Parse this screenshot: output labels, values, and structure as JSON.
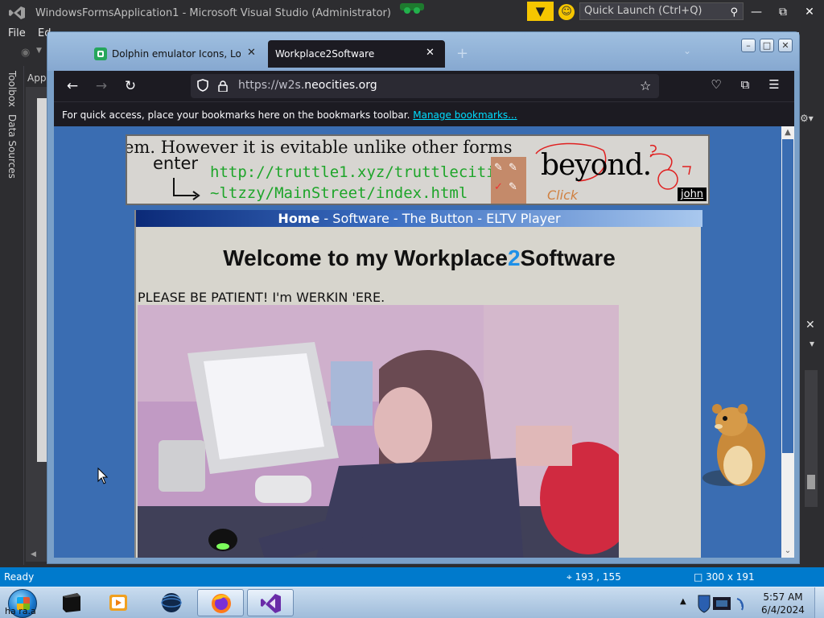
{
  "vs": {
    "title": "WindowsFormsApplication1 - Microsoft Visual Studio (Administrator)",
    "quick_launch_placeholder": "Quick Launch (Ctrl+Q)",
    "menu": {
      "file": "File",
      "edit_partial": "Ed"
    },
    "left_tabs": {
      "toolbox": "Toolbox",
      "data_sources": "Data Sources"
    },
    "editor_tab_partial": "App",
    "status": {
      "ready": "Ready",
      "position": "193 , 155",
      "size": "300 x 191"
    },
    "colors": {
      "status_bar": "#007acc",
      "chrome": "#2d2d30"
    }
  },
  "firefox": {
    "tabs": [
      {
        "label": "Dolphin emulator Icons, Logos, Symbols",
        "favicon": "dolphin-favicon",
        "active": false
      },
      {
        "label": "Workplace2Software",
        "active": true
      }
    ],
    "url": {
      "prefix": "https://w2s.",
      "domain": "neocities.org"
    },
    "bookmarks_msg": "For quick access, place your bookmarks here on the bookmarks toolbar.",
    "bookmarks_link": "Manage bookmarks..."
  },
  "site": {
    "banner": {
      "marquee": "em. However it is evitable unlike other forms",
      "enter": "enter",
      "url_line1": "http://truttle1.xyz/truttlecities/",
      "url_line2": "~ltzzy/MainStreet/index.html",
      "beyond": "beyond.",
      "click": "Click",
      "john": "john"
    },
    "nav": {
      "home": "Home",
      "sep": " - ",
      "software": "Software",
      "button": "The Button",
      "eltv": "ELTV Player"
    },
    "title_pre": "Welcome to my Workplace",
    "title_num": "2",
    "title_post": "Software",
    "warning": "PLEASE BE PATIENT! I'm WERKIN 'ERE.",
    "colors": {
      "background": "#3a6db2",
      "panel": "#d7d5cd",
      "accent_two": "#1e90e8",
      "link_green": "#1ea52a"
    }
  },
  "taskbar": {
    "start_label": "ha ra.a",
    "clock_time": "5:57 AM",
    "clock_date": "6/4/2024",
    "items": [
      "black-window-app",
      "media-player",
      "dark-globe-app",
      "firefox",
      "visual-studio"
    ]
  }
}
